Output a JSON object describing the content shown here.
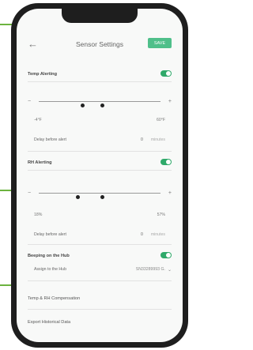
{
  "header": {
    "title": "Sensor Settings",
    "action_label": "SAVE"
  },
  "temp_alerting": {
    "label": "Temp Alerting",
    "enabled": true,
    "range_min": "-4°F",
    "range_max": "60°F",
    "low_fraction": 0.36,
    "high_fraction": 0.52,
    "deviation_label": "Delay before alert",
    "deviation_value": "0",
    "deviation_unit": "minutes"
  },
  "rh_alerting": {
    "label": "RH Alerting",
    "enabled": true,
    "range_min": "18%",
    "range_max": "57%",
    "low_fraction": 0.32,
    "high_fraction": 0.52,
    "deviation_label": "Delay before alert",
    "deviation_value": "0",
    "deviation_unit": "minutes"
  },
  "beeping": {
    "label": "Beeping on the Hub",
    "enabled": true,
    "assign_label": "Assign to the Hub",
    "assign_value": "SN33289993 G."
  },
  "links": {
    "compensation_label": "Temp & RH Compensation",
    "export_label": "Export Historical Data"
  },
  "colors": {
    "accent": "#2fa96a",
    "callout": "#6cb33f",
    "save_pill": "#4fbf8a"
  },
  "icons": {
    "back": "back-arrow-icon",
    "minus": "minus-icon",
    "plus": "plus-icon"
  }
}
